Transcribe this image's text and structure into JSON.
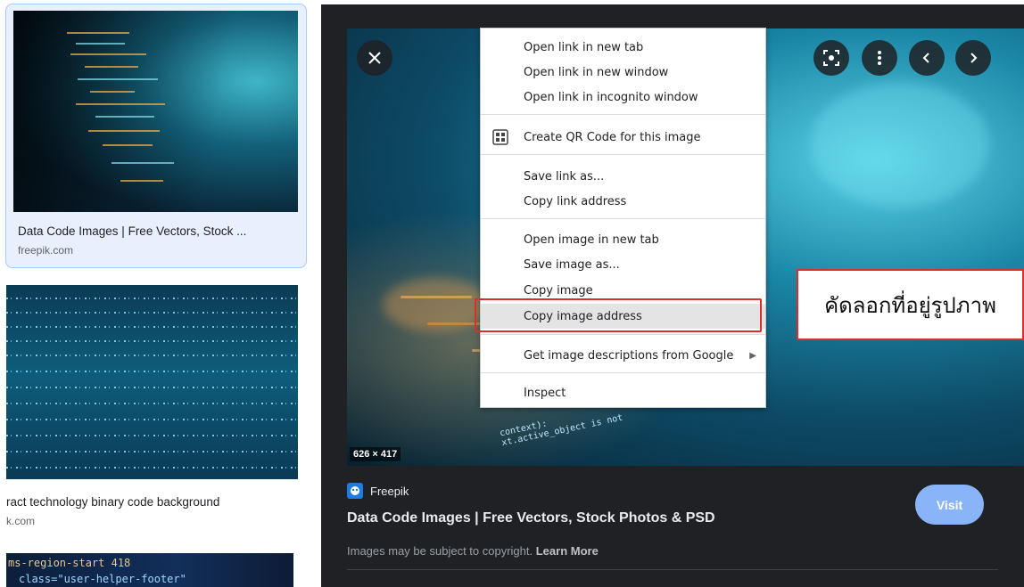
{
  "left_results": [
    {
      "title": "Data Code Images | Free Vectors, Stock ...",
      "source": "freepik.com"
    },
    {
      "title": "ract technology binary code background",
      "source": "k.com"
    },
    {
      "code_snippet_1": "ms-region-start 418",
      "code_snippet_2": "class=\"user-helper-footer\""
    }
  ],
  "preview": {
    "dimensions": "626 × 417",
    "overlay_code_1": "context):",
    "overlay_code_2": "xt.active_object is not",
    "source_name": "Freepik",
    "title": "Data Code Images | Free Vectors, Stock Photos & PSD",
    "visit_label": "Visit",
    "copyright_text": "Images may be subject to copyright.",
    "learn_more": "Learn More",
    "buttons": [
      "close-icon",
      "lens-icon",
      "more-vert-icon",
      "chevron-left-icon",
      "chevron-right-icon"
    ]
  },
  "context_menu": {
    "items": [
      {
        "label": "Open link in new tab"
      },
      {
        "label": "Open link in new window"
      },
      {
        "label": "Open link in incognito window"
      },
      {
        "label": "Create QR Code for this image",
        "icon": "qr-code-icon"
      },
      {
        "label": "Save link as..."
      },
      {
        "label": "Copy link address"
      },
      {
        "label": "Open image in new tab"
      },
      {
        "label": "Save image as..."
      },
      {
        "label": "Copy image"
      },
      {
        "label": "Copy image address",
        "highlighted": true
      },
      {
        "label": "Get image descriptions from Google",
        "submenu": true
      },
      {
        "label": "Inspect"
      }
    ]
  },
  "callout": {
    "text": "คัดลอกที่อยู่รูปภาพ"
  },
  "colors": {
    "highlight_border": "#d9302c",
    "visit_button": "#8ab4f8",
    "panel_bg": "#202124",
    "selected_card_bg": "#e8f0fe"
  }
}
